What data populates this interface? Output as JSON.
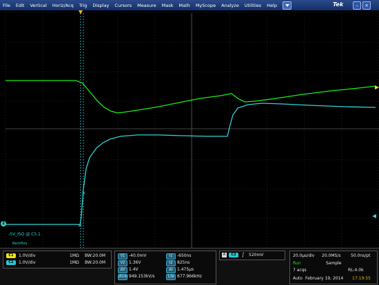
{
  "menu": {
    "items": [
      "File",
      "Edit",
      "Vertical",
      "Horiz/Acq",
      "Trig",
      "Display",
      "Cursors",
      "Measure",
      "Mask",
      "Math",
      "MyScope",
      "Analyze",
      "Utilities",
      "Help"
    ],
    "brand": "Tek"
  },
  "screen": {
    "ch2_label": "-5V_ISO @ C5.1",
    "ch2_sublabel": "Rectifies",
    "ch2_marker": "2",
    "colors": {
      "ch1": "#19ee19",
      "ch2": "#2fd4d8",
      "grid": "#3a3a3a"
    }
  },
  "channels": [
    {
      "badge": "C1",
      "scale": "1.0V/div",
      "imp": "1MΩ",
      "bw": "B<sub>W</sub>:20.0M",
      "color": "#f0e020"
    },
    {
      "badge": "C2",
      "scale": "1.0V/div",
      "imp": "1MΩ",
      "bw": "B<sub>W</sub>:20.0M",
      "color": "#28c8d8"
    }
  ],
  "bw_label": "BW:20.0M",
  "measurements": [
    {
      "badge": "V1",
      "value": "-40.0mV"
    },
    {
      "badge": "V2",
      "value": "1.36V"
    },
    {
      "badge": "ΔV",
      "value": "1.4V"
    },
    {
      "badge": "dV/dt",
      "value": "949.153kV/s"
    }
  ],
  "time_measurements": [
    {
      "badge": "t1",
      "value": "-650ns"
    },
    {
      "badge": "t2",
      "value": "825ns"
    },
    {
      "badge": "Δt",
      "value": "1.475µs"
    },
    {
      "badge": "1/Δt",
      "value": "677.966kHz"
    }
  ],
  "trigger": {
    "badge": "C2",
    "slope": "∫",
    "level": "520mV"
  },
  "acquisition": {
    "horiz": "20.0µs/div",
    "rate": "20.0MS/s",
    "res": "50.0ns/pt",
    "state": "Run",
    "mode": "Sample",
    "acqs": "7 acqs",
    "rl": "RL:4.0k",
    "auto": "Auto",
    "date": "February 19, 2014",
    "time": "17:19:55"
  }
}
